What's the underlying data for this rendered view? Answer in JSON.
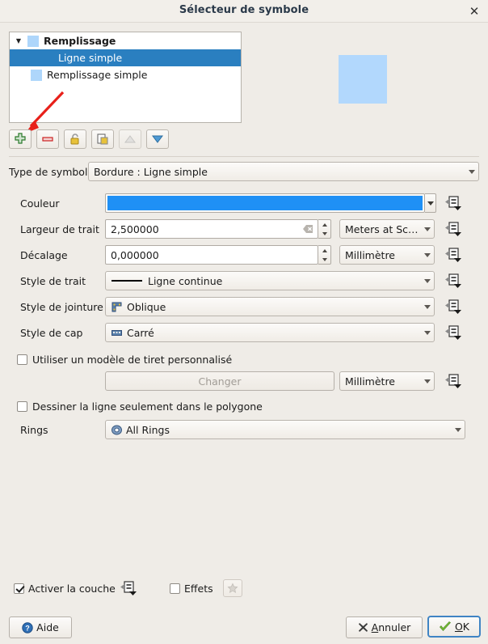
{
  "window": {
    "title": "Sélecteur de symbole",
    "close_label": "✕"
  },
  "colors": {
    "dialog_bg": "#efece7",
    "selection": "#2a7fc0",
    "tree_swatch": "#aed6fb",
    "preview_fill": "#b2d8fd",
    "stroke_color": "#1f90f5",
    "title_text": "#2b3a4a"
  },
  "layer_tree": {
    "items": [
      {
        "label": "Remplissage",
        "depth": 0,
        "bold": true,
        "has_twisty": true,
        "swatch": "#aed6fb",
        "selected": false
      },
      {
        "label": "Ligne simple",
        "depth": 1,
        "bold": false,
        "has_twisty": false,
        "swatch": "",
        "selected": true
      },
      {
        "label": "Remplissage simple",
        "depth": 1,
        "bold": false,
        "has_twisty": false,
        "swatch": "#aed6fb",
        "selected": false
      }
    ]
  },
  "toolbar": {
    "buttons": [
      {
        "name": "add-symbol-layer-button",
        "icon": "plus-icon",
        "enabled": true
      },
      {
        "name": "remove-symbol-layer-button",
        "icon": "minus-icon",
        "enabled": true
      },
      {
        "name": "lock-layer-button",
        "icon": "padlock-icon",
        "enabled": true
      },
      {
        "name": "duplicate-layer-button",
        "icon": "duplicate-icon",
        "enabled": true
      },
      {
        "name": "move-up-button",
        "icon": "triangle-up-icon",
        "enabled": false
      },
      {
        "name": "move-down-button",
        "icon": "triangle-down-icon",
        "enabled": true
      }
    ]
  },
  "form": {
    "symbol_type": {
      "label": "Type de symbole",
      "value": "Bordure : Ligne simple"
    },
    "color": {
      "label": "Couleur",
      "value": "#1f90f5"
    },
    "stroke_width": {
      "label": "Largeur de trait",
      "value": "2,500000",
      "unit": "Meters at Scale"
    },
    "offset": {
      "label": "Décalage",
      "value": "0,000000",
      "unit": "Millimètre"
    },
    "stroke_style": {
      "label": "Style de trait",
      "value": "Ligne continue"
    },
    "join_style": {
      "label": "Style de jointure",
      "value": "Oblique"
    },
    "cap_style": {
      "label": "Style de cap",
      "value": "Carré"
    },
    "custom_dash": {
      "label": "Utiliser un modèle de tiret personnalisé",
      "checked": false
    },
    "dash_change": {
      "label": "Changer",
      "unit": "Millimètre",
      "enabled": false
    },
    "draw_inside_polygon": {
      "label": "Dessiner la ligne seulement dans le polygone",
      "checked": false
    },
    "rings": {
      "label": "Rings",
      "value": "All Rings"
    }
  },
  "footer": {
    "enable_layer": {
      "label": "Activer la couche",
      "checked": true
    },
    "effects": {
      "label": "Effets",
      "checked": false
    },
    "help_label": "Aide",
    "cancel_label": "Annuler",
    "cancel_mnemonic": "A",
    "ok_label": "OK",
    "ok_mnemonic": "O"
  },
  "annotation": {
    "arrow_color": "#e8201a",
    "points_to": "add-symbol-layer-button"
  }
}
